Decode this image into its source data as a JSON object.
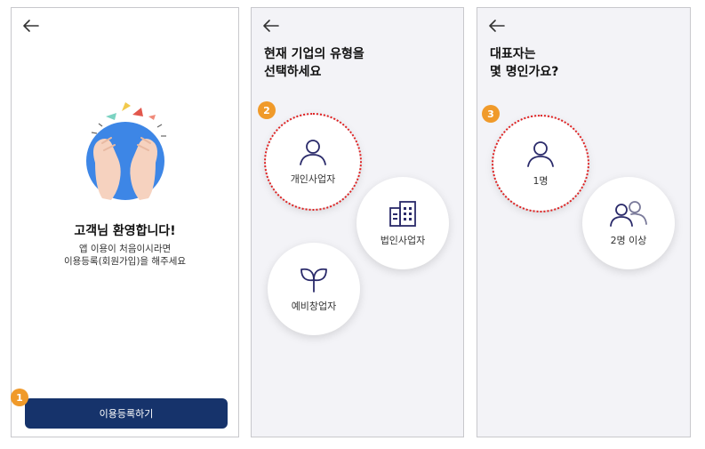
{
  "steps": [
    "1",
    "2",
    "3"
  ],
  "screen1": {
    "welcome_title": "고객님 환영합니다!",
    "welcome_line1": "앱 이용이 처음이시라면",
    "welcome_line2": "이용등록(회원가입)을 해주세요",
    "register_button": "이용등록하기",
    "illustration": "clapping-hands-illustration"
  },
  "screen2": {
    "title_line1": "현재 기업의 유형을",
    "title_line2": "선택하세요",
    "options": [
      {
        "label": "개인사업자",
        "icon": "person-icon",
        "selected": true
      },
      {
        "label": "법인사업자",
        "icon": "building-icon",
        "selected": false
      },
      {
        "label": "예비창업자",
        "icon": "sprout-icon",
        "selected": false
      }
    ]
  },
  "screen3": {
    "title_line1": "대표자는",
    "title_line2": "몇 명인가요?",
    "options": [
      {
        "label": "1명",
        "icon": "person-icon",
        "selected": true
      },
      {
        "label": "2명 이상",
        "icon": "people-icon",
        "selected": false
      }
    ]
  },
  "colors": {
    "primary_button": "#16336b",
    "step_badge": "#f09a2a",
    "selection_ring": "#e02020",
    "icon_stroke": "#2a2a6a"
  }
}
